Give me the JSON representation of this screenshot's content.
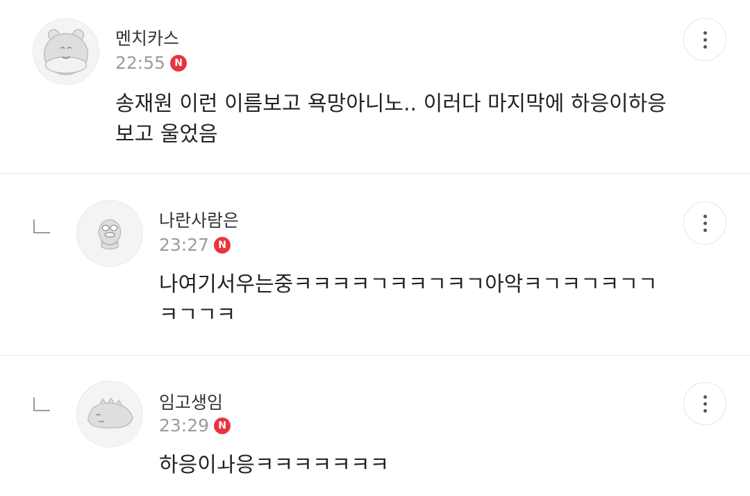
{
  "comments": [
    {
      "nickname": "멘치카스",
      "time": "22:55",
      "badge": "N",
      "text": "송재원 이런 이름보고 욕망아니노.. 이러다 마지막에 하응이하응\n보고 울었음",
      "avatar_icon": "bear-character-icon",
      "is_reply": false
    },
    {
      "nickname": "나란사람은",
      "time": "23:27",
      "badge": "N",
      "text": "나여기서우는중ㅋㅋㅋㅋㄱㅋㅋㄱㅋㄱ아악ㅋㄱㅋㄱㅋㄱㄱ\nㅋㄱㄱㅋ",
      "avatar_icon": "duck-character-icon",
      "is_reply": true
    },
    {
      "nickname": "임고생임",
      "time": "23:29",
      "badge": "N",
      "text": "하응이ㅘ응ㅋㅋㅋㅋㅋㅋㅋ",
      "avatar_icon": "dinosaur-character-icon",
      "is_reply": true
    }
  ],
  "icons": {
    "more": "more-vertical-icon",
    "reply": "reply-arrow-icon"
  },
  "colors": {
    "new_badge": "#e8343f",
    "time": "#9b9b9b",
    "divider": "#e6e6e6"
  }
}
